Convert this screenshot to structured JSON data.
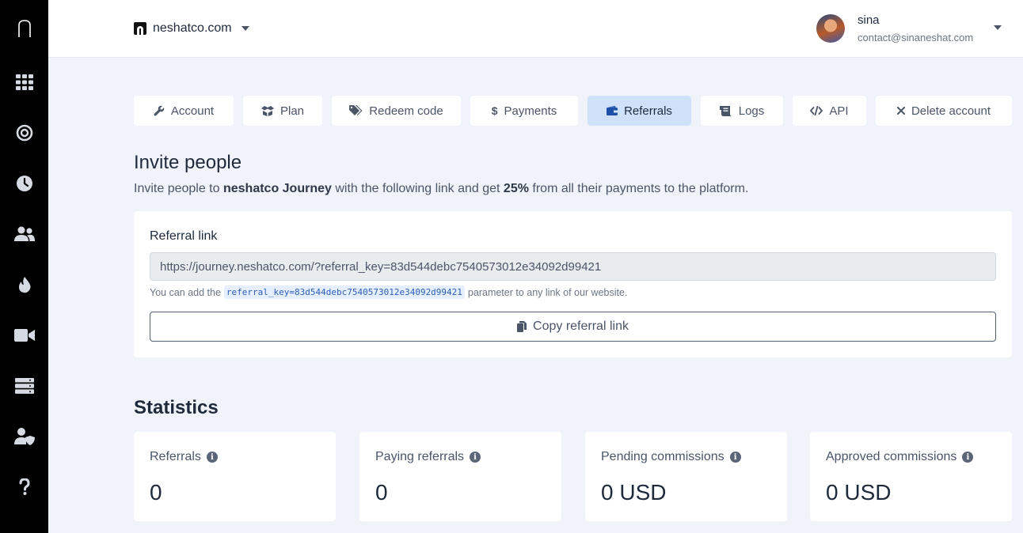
{
  "header": {
    "workspace": "neshatco.com",
    "user": {
      "name": "sina",
      "email": "contact@sinaneshat.com"
    }
  },
  "sidebar": {
    "logo": "n",
    "items": [
      "apps-grid-icon",
      "target-icon",
      "clock-icon",
      "users-icon",
      "fire-icon",
      "video-icon",
      "server-icon",
      "user-shield-icon",
      "help-icon"
    ]
  },
  "tabs": [
    {
      "label": "Account",
      "icon": "wrench-icon"
    },
    {
      "label": "Plan",
      "icon": "box-icon"
    },
    {
      "label": "Redeem code",
      "icon": "tags-icon"
    },
    {
      "label": "Payments",
      "icon": "dollar-icon"
    },
    {
      "label": "Referrals",
      "icon": "wallet-icon",
      "active": true
    },
    {
      "label": "Logs",
      "icon": "receipt-icon"
    },
    {
      "label": "API",
      "icon": "code-icon"
    },
    {
      "label": "Delete account",
      "icon": "x-icon"
    }
  ],
  "invite": {
    "title": "Invite people",
    "desc_pre": "Invite people to ",
    "desc_brand": "neshatco Journey",
    "desc_mid": " with the following link and get ",
    "desc_pct": "25%",
    "desc_post": " from all their payments to the platform.",
    "label": "Referral link",
    "link": "https://journey.neshatco.com/?referral_key=83d544debc7540573012e34092d99421",
    "help_pre": "You can add the",
    "help_code": "referral_key=83d544debc7540573012e34092d99421",
    "help_post": "parameter to any link of our website.",
    "copy_label": "Copy referral link"
  },
  "stats": {
    "title": "Statistics",
    "cards": [
      {
        "label": "Referrals",
        "value": "0"
      },
      {
        "label": "Paying referrals",
        "value": "0"
      },
      {
        "label": "Pending commissions",
        "value": "0 USD"
      },
      {
        "label": "Approved commissions",
        "value": "0 USD"
      }
    ]
  }
}
